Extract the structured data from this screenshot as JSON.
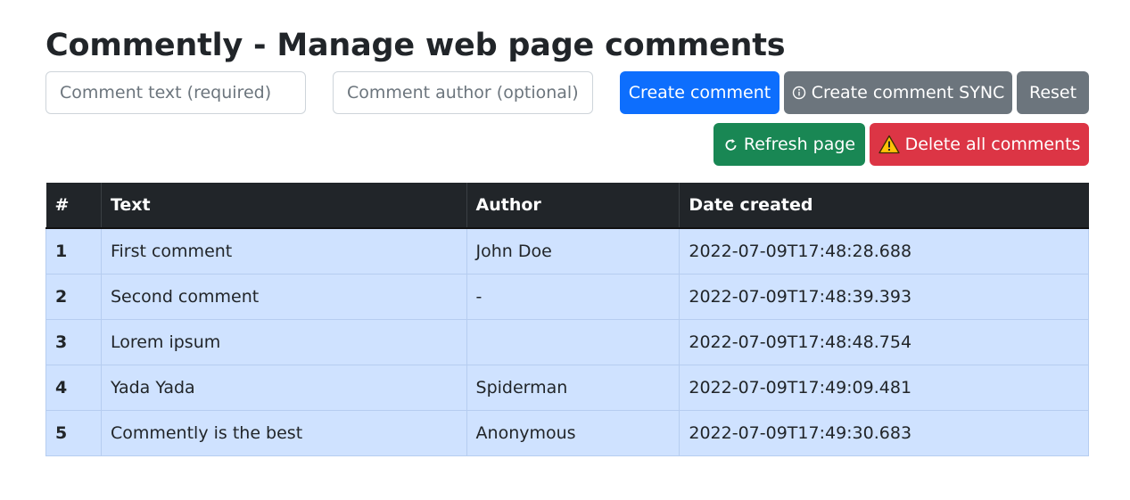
{
  "title": "Commently - Manage web page comments",
  "inputs": {
    "text_placeholder": "Comment text (required)",
    "author_placeholder": "Comment author (optional)",
    "text_value": "",
    "author_value": ""
  },
  "buttons": {
    "create": "Create comment",
    "create_sync": "Create comment SYNC",
    "reset": "Reset",
    "refresh": "Refresh page",
    "delete_all": "Delete all comments"
  },
  "icons": {
    "create_sync": "info-icon",
    "refresh": "refresh-icon",
    "delete_all": "warning-icon"
  },
  "colors": {
    "primary": "#0d6efd",
    "secondary": "#6c757d",
    "success": "#198754",
    "danger": "#dc3545",
    "table_header": "#212529",
    "table_row": "#cfe2ff"
  },
  "table": {
    "headers": [
      "#",
      "Text",
      "Author",
      "Date created"
    ],
    "rows": [
      {
        "num": "1",
        "text": "First comment",
        "author": "John Doe",
        "date": "2022-07-09T17:48:28.688"
      },
      {
        "num": "2",
        "text": "Second comment",
        "author": "-",
        "date": "2022-07-09T17:48:39.393"
      },
      {
        "num": "3",
        "text": "Lorem ipsum",
        "author": "",
        "date": "2022-07-09T17:48:48.754"
      },
      {
        "num": "4",
        "text": "Yada Yada",
        "author": "Spiderman",
        "date": "2022-07-09T17:49:09.481"
      },
      {
        "num": "5",
        "text": "Commently is the best",
        "author": "Anonymous",
        "date": "2022-07-09T17:49:30.683"
      }
    ]
  }
}
